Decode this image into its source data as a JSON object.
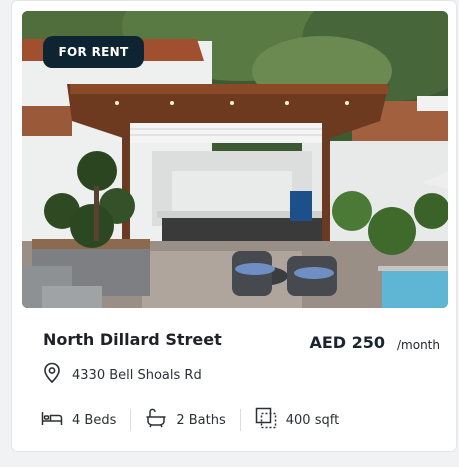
{
  "listing": {
    "badge": "FOR RENT",
    "title": "North Dillard Street",
    "price": "AED 250",
    "price_unit": "/month",
    "address": "4330 Bell Shoals Rd",
    "beds": "4 Beds",
    "baths": "2 Baths",
    "area": "400 sqft"
  },
  "colors": {
    "badge_bg": "#0e2433",
    "price_text": "#1a2530"
  },
  "icons": [
    "location-pin-icon",
    "bed-icon",
    "bathtub-icon",
    "area-icon"
  ]
}
